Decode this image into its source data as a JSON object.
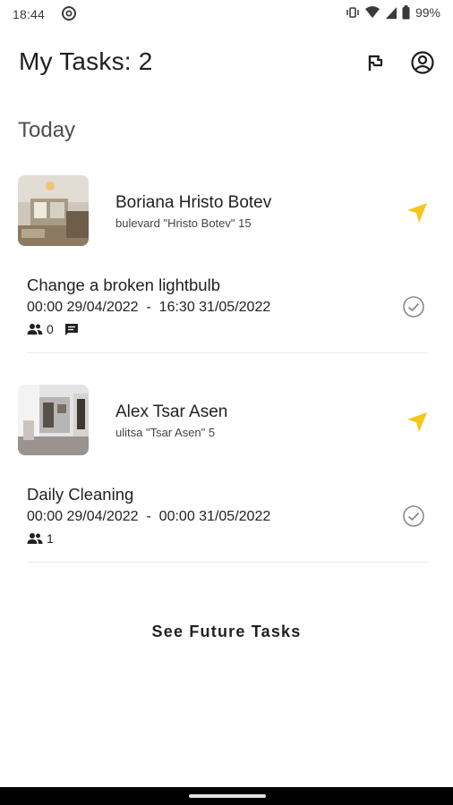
{
  "status_bar": {
    "time": "18:44",
    "battery": "99%"
  },
  "header": {
    "title": "My Tasks: 2",
    "flag_icon": "flag-icon",
    "account_icon": "account-circle-icon"
  },
  "section": {
    "title": "Today"
  },
  "tasks": [
    {
      "property_name": "Boriana Hristo Botev",
      "address": "bulevard \"Hristo Botev\" 15",
      "task_title": "Change a broken lightbulb",
      "dates": "00:00 29/04/2022  -  16:30 31/05/2022",
      "people_count": "0",
      "has_comments": true
    },
    {
      "property_name": "Alex Tsar Asen",
      "address": "ulitsa \"Tsar Asen\" 5",
      "task_title": "Daily Cleaning",
      "dates": "00:00 29/04/2022  -  00:00 31/05/2022",
      "people_count": "1",
      "has_comments": false
    }
  ],
  "future_button": "See Future Tasks",
  "colors": {
    "accent": "#f5c518",
    "text": "#222222",
    "check": "#8a8a8a",
    "divider": "#e8e8e8"
  }
}
